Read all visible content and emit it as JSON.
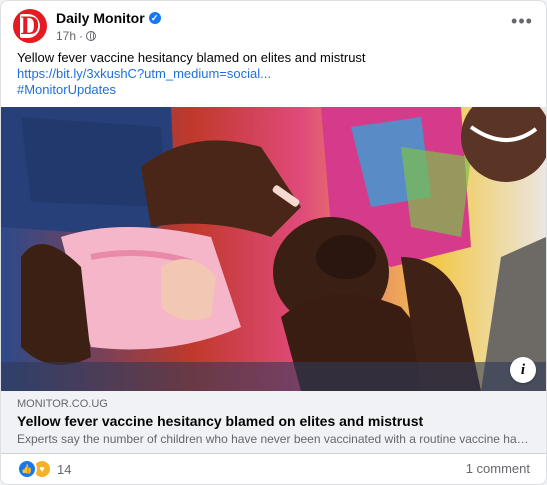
{
  "post": {
    "page_name": "Daily Monitor",
    "time": "17h",
    "dot": "·",
    "more_label": "•••",
    "text": "Yellow fever vaccine hesitancy blamed on elites and mistrust",
    "link": "https://bit.ly/3xkushC?utm_medium=social...",
    "hashtag": "#MonitorUpdates"
  },
  "avatar": {
    "letter": "D"
  },
  "preview": {
    "domain": "MONITOR.CO.UG",
    "title": "Yellow fever vaccine hesitancy blamed on elites and mistrust",
    "description": "Experts say the number of children who have never been vaccinated with a routine vaccine has...",
    "info_label": "i"
  },
  "footer": {
    "reaction_count": "14",
    "comments": "1 comment"
  },
  "icons": {
    "verified": "verified-badge-icon",
    "globe": "globe-icon",
    "like": "like-reaction-icon",
    "care": "care-reaction-icon"
  },
  "colors": {
    "brand_red": "#e41b23",
    "link_blue": "#216fdb",
    "facebook_blue": "#1877f2"
  }
}
